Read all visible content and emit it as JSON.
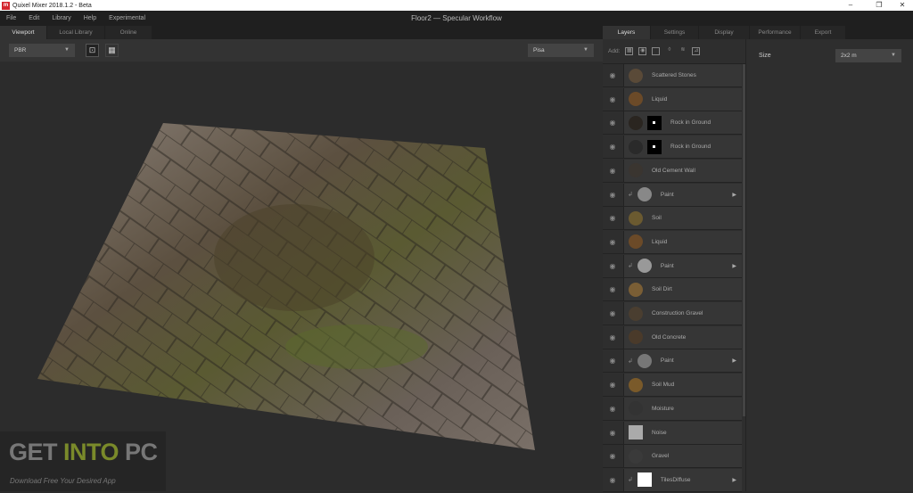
{
  "window": {
    "title": "Quixel Mixer 2018.1.2 - Beta",
    "logo": "m",
    "document_title": "Floor2 — Specular Workflow",
    "minimize": "–",
    "maximize": "❐",
    "close": "✕"
  },
  "menu": [
    "File",
    "Edit",
    "Library",
    "Help",
    "Experimental"
  ],
  "left_tabs": [
    "Viewport",
    "Local Library",
    "Online"
  ],
  "viewport_toolbar": {
    "mode": "PBR",
    "environment": "Pisa"
  },
  "right_tabs": [
    "Layers",
    "Settings",
    "Display",
    "Performance",
    "Export"
  ],
  "add_label": "Add:",
  "layers": [
    {
      "name": "Scattered Stones",
      "color": "#5a4a38"
    },
    {
      "name": "Liquid",
      "color": "#6b4a28"
    },
    {
      "name": "Rock in Ground",
      "color": "#2a2520",
      "mask": true
    },
    {
      "name": "Rock in Ground",
      "color": "#2a2a2a",
      "mask": true
    },
    {
      "name": "Old Cement Wall",
      "color": "#3a3530"
    },
    {
      "name": "Paint",
      "color": "#888",
      "group": true
    },
    {
      "name": "Soil",
      "color": "#6b5a30"
    },
    {
      "name": "Liquid",
      "color": "#6b4a28"
    },
    {
      "name": "Paint",
      "color": "#999",
      "group": true
    },
    {
      "name": "Soil Dirt",
      "color": "#7a5e35"
    },
    {
      "name": "Construction Gravel",
      "color": "#4a3e30"
    },
    {
      "name": "Old Concrete",
      "color": "#4a3a2a"
    },
    {
      "name": "Paint",
      "color": "#777",
      "group": true
    },
    {
      "name": "Soil Mud",
      "color": "#7a5a2a"
    },
    {
      "name": "Moisture",
      "color": "#333"
    },
    {
      "name": "Noise",
      "color": "#aaa",
      "noise": true
    },
    {
      "name": "Gravel",
      "color": "#3a3a3a"
    },
    {
      "name": "TilesDiffuse",
      "color": "#fff",
      "square": true,
      "group": true
    }
  ],
  "properties": {
    "size_label": "Size",
    "size_value": "2x2 m"
  },
  "watermark": {
    "get": "GET ",
    "into": "INTO",
    "pc": " PC",
    "tagline": "Download Free Your Desired App"
  }
}
